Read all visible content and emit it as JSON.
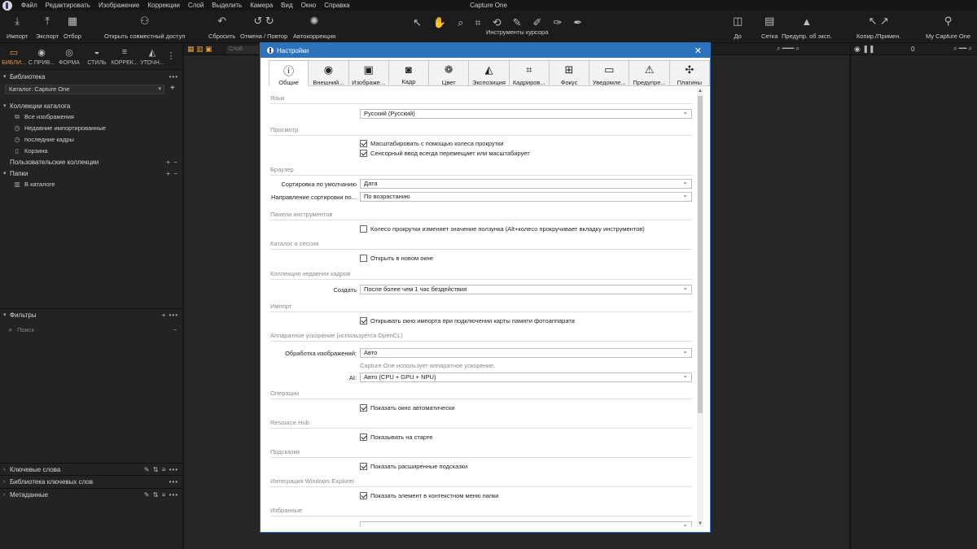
{
  "menu": [
    "Файл",
    "Редактировать",
    "Изображение",
    "Коррекции",
    "Слой",
    "Выделить",
    "Камера",
    "Вид",
    "Окно",
    "Справка"
  ],
  "window_title": "Capture One",
  "toolbar": {
    "left": [
      {
        "label": "Импорт",
        "icon": "import-icon"
      },
      {
        "label": "Экспорт",
        "icon": "export-icon"
      },
      {
        "label": "Отбор",
        "icon": "cull-icon"
      },
      {
        "label": "Открыть совместный доступ",
        "icon": "share-icon"
      },
      {
        "label": "Сбросить",
        "icon": "reset-icon"
      },
      {
        "label": "Отмена / Повтор",
        "icon": "undo-redo-icon"
      },
      {
        "label": "Автокоррекция",
        "icon": "auto-adjust-icon"
      }
    ],
    "center_label": "Инструменты курсора",
    "right": [
      {
        "label": "До",
        "icon": "before-icon"
      },
      {
        "label": "Сетка",
        "icon": "grid-icon"
      },
      {
        "label": "Предупр. об эксп.",
        "icon": "exposure-warning-icon"
      },
      {
        "label": "Копир./Примен.",
        "icon": "copy-apply-icon"
      },
      {
        "label": "My Capture One",
        "icon": "user-icon"
      }
    ]
  },
  "left_panel": {
    "tabs": [
      "БИБЛИ...",
      "С ПРИВ...",
      "ФОРМА",
      "СТИЛЬ",
      "КОРРЕК...",
      "УТОЧН..."
    ],
    "library_title": "Библиотека",
    "catalog": "Каталог: Capture One",
    "catalog_collections": "Коллекции каталога",
    "items": [
      "Все изображения",
      "Недавние импортированные",
      "последние кадры",
      "Корзина"
    ],
    "user_collections": "Пользовательские коллекции",
    "folders": "Папки",
    "in_catalog": "В каталоге",
    "filters": "Фильтры",
    "search_placeholder": "Поиск",
    "keywords": "Ключевые слова",
    "keyword_library": "Библиотека ключевых слов",
    "metadata": "Метаданные"
  },
  "viewer": {
    "layer_placeholder": "Слой",
    "right_value": "0"
  },
  "dialog": {
    "title": "Настройки",
    "tabs": [
      "Общие",
      "Внешний...",
      "Изображе...",
      "Кадр",
      "Цвет",
      "Экспозиция",
      "Кадриров...",
      "Фокус",
      "Уведомле...",
      "Предупре...",
      "Плагины"
    ],
    "sections": {
      "language": "Язык",
      "language_value": "Русский (Русский)",
      "viewer": "Просмотр",
      "viewer_opt1": "Масштабировать с помощью колеса прокрутки",
      "viewer_opt2": "Сенсорный ввод всегда перемещает или масштабирует",
      "browser": "Браузер",
      "sort_label": "Сортировка по умолчанию",
      "sort_value": "Дата",
      "sort_dir_label": "Направление сортировки по...",
      "sort_dir_value": "По возрастанию",
      "tool_panels": "Панели инструментов",
      "tool_opt": "Колесо прокрутки изменяет значение ползунка (Alt+колесо прокручивает вкладку инструментов)",
      "catalog_session": "Каталог и сессия",
      "catalog_opt": "Открыть в новом окне",
      "recent": "Коллекция недавних кадров",
      "create_label": "Создать",
      "create_value": "После более чем 1 час бездействия",
      "import": "Импорт",
      "import_opt": "Открывать окно импорта при подключении карты памяти фотоаппарата",
      "hw": "Аппаратное ускорение (используется OpenCL)",
      "processing_label": "Обработка изображений:",
      "processing_value": "Авто",
      "hw_note": "Capture One использует аппаратное ускорение.",
      "ai_label": "AI:",
      "ai_value": "Авто (CPU + GPU + NPU)",
      "operations": "Операции",
      "operations_opt": "Показать окно автоматически",
      "resource_hub": "Resource Hub",
      "resource_opt": "Показывать на старте",
      "hints": "Подсказки",
      "hints_opt": "Показать расширенные подсказки",
      "explorer": "Интеграция Windows Explorer",
      "explorer_opt": "Показать элемент в контекстном меню папки",
      "favorites": "Избранные"
    }
  }
}
